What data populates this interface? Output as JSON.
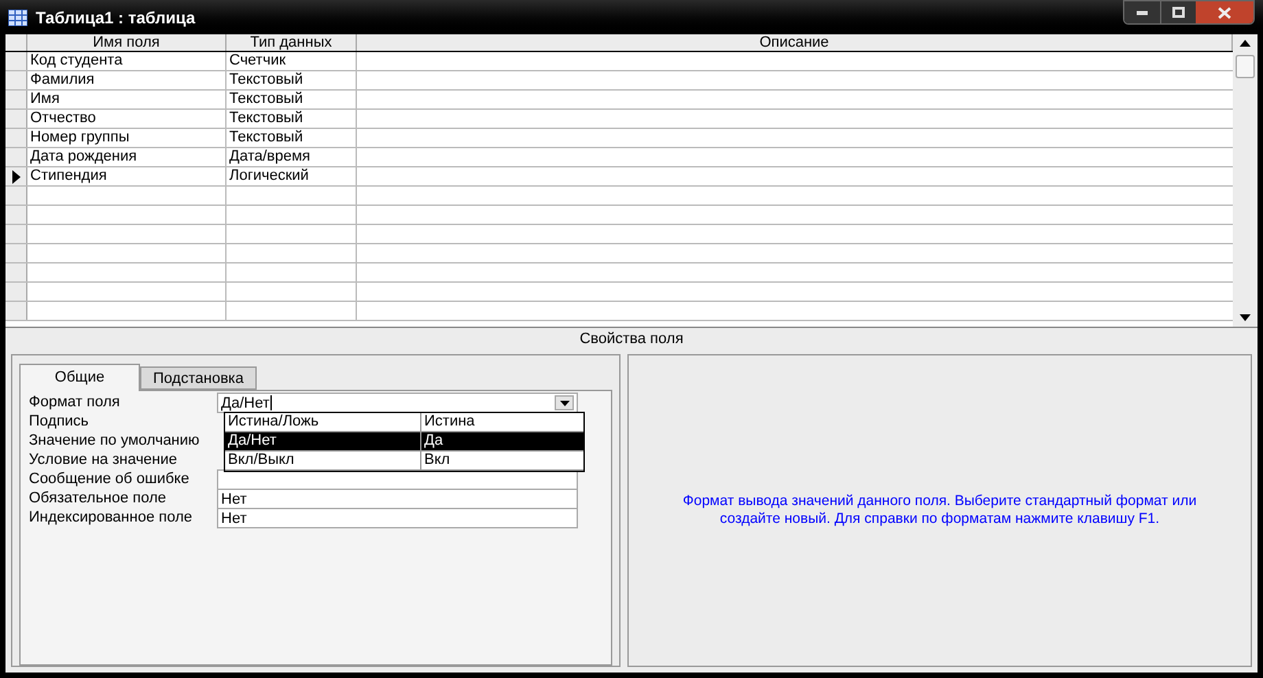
{
  "window": {
    "title": "Таблица1 : таблица"
  },
  "grid": {
    "columns": [
      "Имя поля",
      "Тип данных",
      "Описание"
    ],
    "rows": [
      {
        "name": "Код студента",
        "type": "Счетчик",
        "selected": false
      },
      {
        "name": "Фамилия",
        "type": "Текстовый",
        "selected": false
      },
      {
        "name": "Имя",
        "type": "Текстовый",
        "selected": false
      },
      {
        "name": "Отчество",
        "type": "Текстовый",
        "selected": false
      },
      {
        "name": "Номер группы",
        "type": "Текстовый",
        "selected": false
      },
      {
        "name": "Дата рождения",
        "type": "Дата/время",
        "selected": false
      },
      {
        "name": "Стипендия",
        "type": "Логический",
        "selected": true
      }
    ]
  },
  "properties": {
    "title": "Свойства поля",
    "tabs": [
      {
        "label": "Общие",
        "selected": true
      },
      {
        "label": "Подстановка",
        "selected": false
      }
    ],
    "rows": [
      {
        "label": "Формат поля",
        "value": "Да/Нет"
      },
      {
        "label": "Подпись"
      },
      {
        "label": "Значение по умолчанию"
      },
      {
        "label": "Условие на значение"
      },
      {
        "label": "Сообщение об ошибке",
        "value": ""
      },
      {
        "label": "Обязательное поле",
        "value": "Нет"
      },
      {
        "label": "Индексированное поле",
        "value": "Нет"
      }
    ],
    "dropdown": [
      {
        "format": "Истина/Ложь",
        "example": "Истина",
        "selected": false
      },
      {
        "format": "Да/Нет",
        "example": "Да",
        "selected": true
      },
      {
        "format": "Вкл/Выкл",
        "example": "Вкл",
        "selected": false
      }
    ],
    "help": "Формат вывода значений данного поля.  Выберите стандартный формат или создайте новый.  Для справки по форматам нажмите клавишу F1."
  }
}
